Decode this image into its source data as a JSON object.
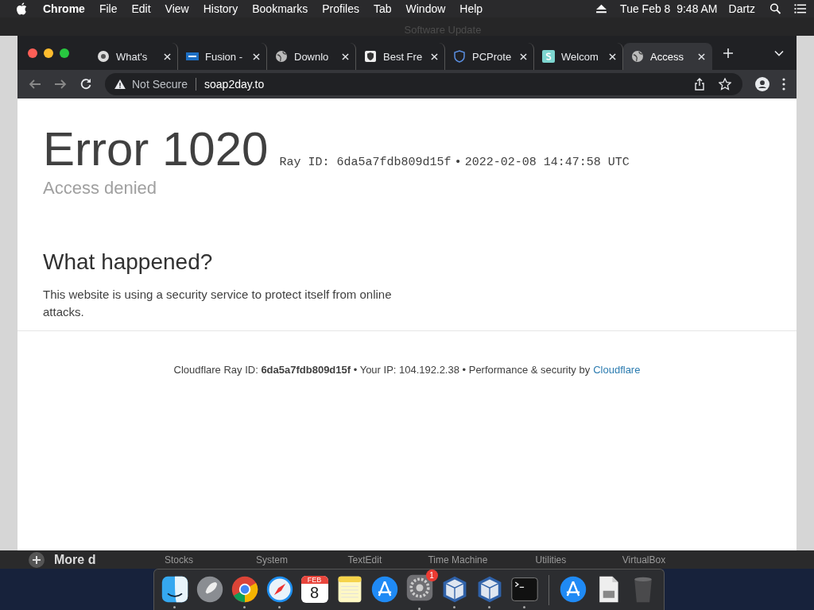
{
  "menubar": {
    "app": "Chrome",
    "menus": [
      "File",
      "Edit",
      "View",
      "History",
      "Bookmarks",
      "Profiles",
      "Tab",
      "Window",
      "Help"
    ],
    "clock": "Tue Feb 8  9:48 AM",
    "user": "Dartz"
  },
  "background_window": {
    "title": "Software Update",
    "more_label": "More d",
    "apps": [
      "Stocks",
      "System",
      "TextEdit",
      "Time Machine",
      "Utilities",
      "VirtualBox"
    ]
  },
  "tabs": [
    {
      "kind": "chrome",
      "title": "What's",
      "selected": false
    },
    {
      "kind": "vmw",
      "title": "Fusion -",
      "selected": false
    },
    {
      "kind": "globe",
      "title": "Downlo",
      "selected": false
    },
    {
      "kind": "lock",
      "title": "Best Fre",
      "selected": false
    },
    {
      "kind": "shield",
      "title": "PCProte",
      "selected": false
    },
    {
      "kind": "s",
      "title": "Welcom",
      "selected": false
    },
    {
      "kind": "globe",
      "title": "Access",
      "selected": true
    }
  ],
  "address": {
    "security": "Not Secure",
    "url": "soap2day.to"
  },
  "page": {
    "title": "Error 1020",
    "ray": "Ray ID: 6da5a7fdb809d15f",
    "bullet": "•",
    "time": "2022-02-08 14:47:58 UTC",
    "subtitle": "Access denied",
    "heading": "What happened?",
    "body": "This website is using a security service to protect itself from online attacks.",
    "footer": "Cloudflare Ray ID: **6da5a7fdb809d15f** • Your IP: 104.192.2.38 • Performance & security by",
    "footer_link": "Cloudflare"
  },
  "dock": [
    {
      "kind": "finder",
      "running": true
    },
    {
      "kind": "launchpad",
      "running": false
    },
    {
      "kind": "chrome",
      "running": true
    },
    {
      "kind": "safari",
      "running": true
    },
    {
      "kind": "calendar",
      "month": "FEB",
      "day": "8",
      "running": false
    },
    {
      "kind": "notes",
      "running": false
    },
    {
      "kind": "appstore",
      "running": false
    },
    {
      "kind": "settings",
      "badge": "1",
      "running": true
    },
    {
      "kind": "vbox",
      "running": true
    },
    {
      "kind": "vbox",
      "running": true
    },
    {
      "kind": "terminal",
      "running": true
    },
    {
      "kind": "separator"
    },
    {
      "kind": "appstore",
      "running": false
    },
    {
      "kind": "file",
      "running": false
    },
    {
      "kind": "trash",
      "running": false
    }
  ]
}
